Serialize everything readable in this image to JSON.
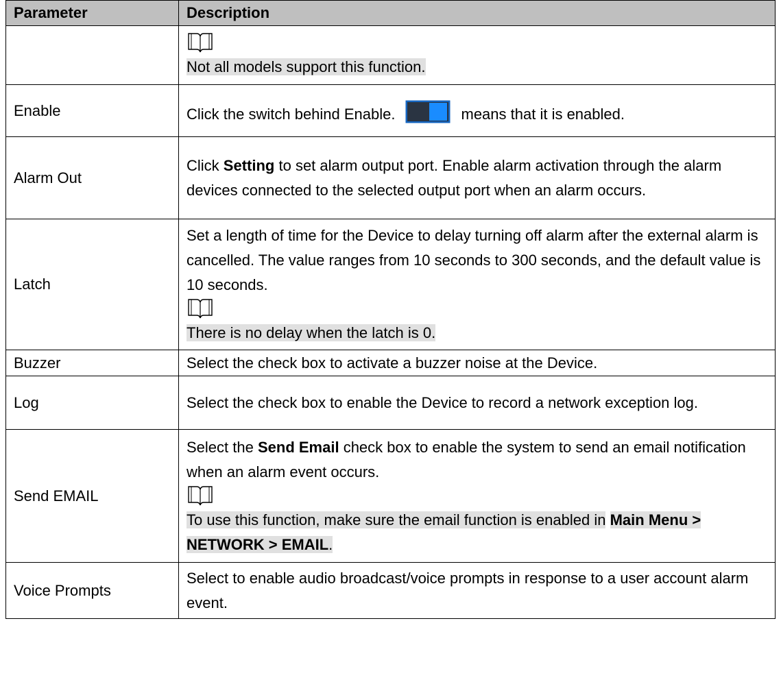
{
  "header": {
    "parameter": "Parameter",
    "description": "Description"
  },
  "rows": [
    {
      "param": "",
      "note_text": "Not all models support this function."
    },
    {
      "param": "Enable",
      "text_before": "Click the switch behind Enable.",
      "text_after": "means that it is enabled."
    },
    {
      "param": "Alarm Out",
      "pre": "Click",
      "bold": "Setting",
      "post": "to set alarm output port. Enable alarm activation through the alarm devices connected to the selected output port when an alarm occurs."
    },
    {
      "param": "Latch",
      "text": "Set a length of time for the Device to delay turning off alarm after the external alarm is cancelled. The value ranges from 10 seconds to 300 seconds, and the default value is 10 seconds.",
      "note_text": "There is no delay when the latch is 0."
    },
    {
      "param": "Buzzer",
      "text": "Select the check box to activate a buzzer noise at the Device."
    },
    {
      "param": "Log",
      "text": "Select the check box to enable the Device to record a network exception log."
    },
    {
      "param": "Send EMAIL",
      "pre": "Select the",
      "bold": "Send Email",
      "post": "check box to enable the system to send an email notification when an alarm event occurs.",
      "note_pre": "To use this function, make sure the email function is enabled in",
      "note_bold": "Main Menu > NETWORK > EMAIL",
      "note_post": "."
    },
    {
      "param": "Voice Prompts",
      "text": "Select to enable audio broadcast/voice prompts in response to a user account alarm event."
    }
  ],
  "icons": {
    "note": "book-note-icon",
    "toggle": "toggle-on-icon"
  },
  "colors": {
    "header_bg": "#bfbfbf",
    "highlight": "#e0e0e0",
    "toggle_bg": "#2a3442",
    "toggle_knob": "#1a8cff",
    "toggle_border": "#1565c0"
  }
}
